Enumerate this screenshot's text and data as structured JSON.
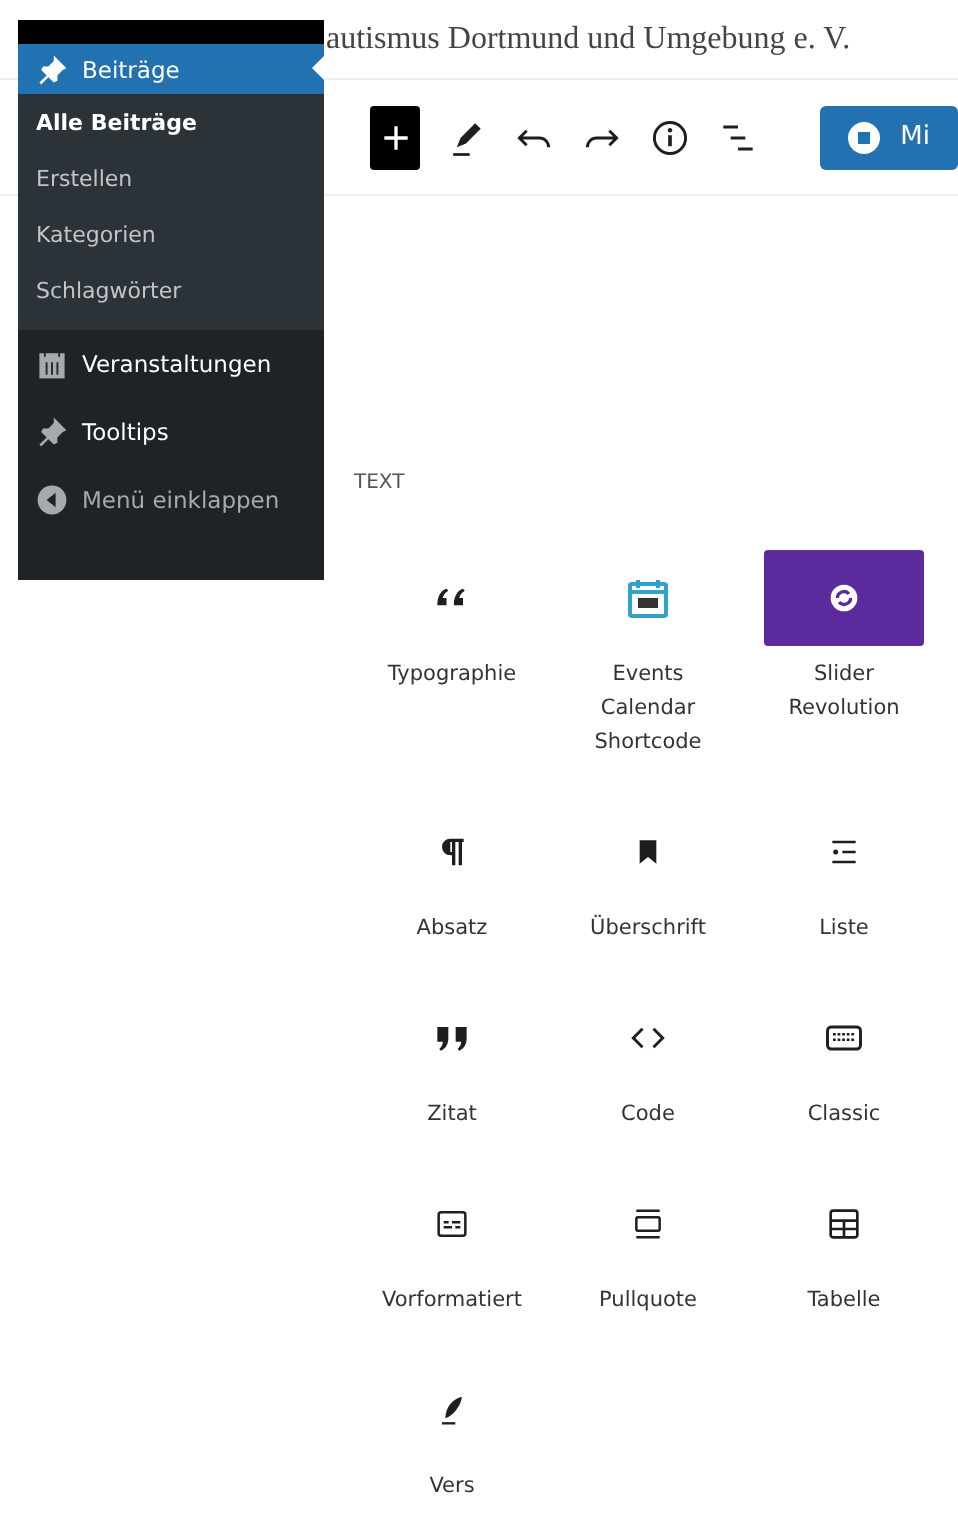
{
  "site_title": "autismus Dortmund und Umgebung e. V.",
  "sidebar": {
    "items": [
      {
        "label": "Beiträge",
        "kind": "pin",
        "selected": true
      },
      {
        "label": "Alle Beiträge",
        "kind": "sub",
        "selected": true
      },
      {
        "label": "Erstellen",
        "kind": "sub",
        "selected": false
      },
      {
        "label": "Kategorien",
        "kind": "sub",
        "selected": false
      },
      {
        "label": "Schlagwörter",
        "kind": "sub",
        "selected": false
      },
      {
        "label": "Veranstaltungen",
        "kind": "calendar",
        "selected": false
      },
      {
        "label": "Tooltips",
        "kind": "pin",
        "selected": false
      },
      {
        "label": "Menü einklappen",
        "kind": "collapse",
        "selected": false
      }
    ]
  },
  "toolbar": {
    "inserter_selected": true,
    "publish_button": "Mi"
  },
  "section_heading": "TEXT",
  "blocks": [
    {
      "label": "Typographie",
      "kind": "typography"
    },
    {
      "label": "Events Calendar Shortcode",
      "kind": "events"
    },
    {
      "label": "Slider Revolution",
      "kind": "slider"
    },
    {
      "label": "Absatz",
      "kind": "paragraph"
    },
    {
      "label": "Überschrift",
      "kind": "heading"
    },
    {
      "label": "Liste",
      "kind": "list"
    },
    {
      "label": "Zitat",
      "kind": "quote"
    },
    {
      "label": "Code",
      "kind": "code"
    },
    {
      "label": "Classic",
      "kind": "classic"
    },
    {
      "label": "Vorformatiert",
      "kind": "preformatted"
    },
    {
      "label": "Pullquote",
      "kind": "pullquote"
    },
    {
      "label": "Tabelle",
      "kind": "table"
    },
    {
      "label": "Vers",
      "kind": "verse"
    }
  ]
}
